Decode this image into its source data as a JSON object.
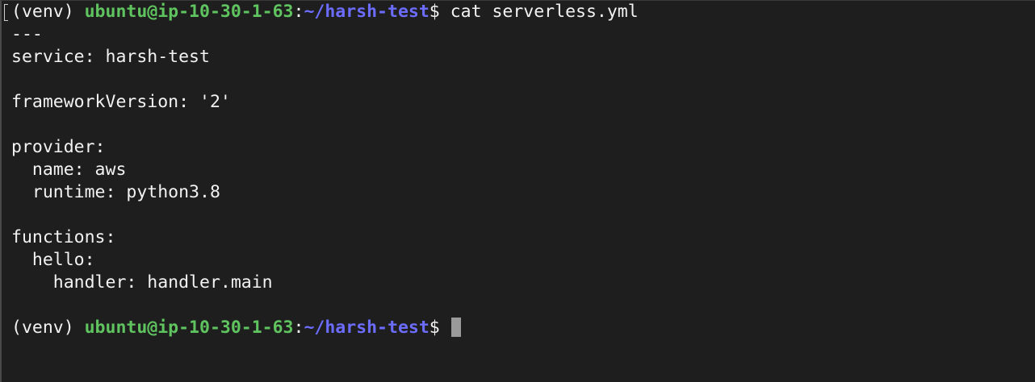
{
  "terminal": {
    "prompt": {
      "venv": "(venv) ",
      "user_host": "ubuntu@ip-10-30-1-63",
      "colon": ":",
      "path": "~/harsh-test",
      "dollar": "$ "
    },
    "command": "cat serverless.yml",
    "output_lines": [
      "---",
      "service: harsh-test",
      "",
      "frameworkVersion: '2'",
      "",
      "provider:",
      "  name: aws",
      "  runtime: python3.8",
      "",
      "functions:",
      "  hello:",
      "    handler: handler.main",
      ""
    ],
    "colors": {
      "background": "#1e1e1e",
      "user_host": "#5fc35f",
      "path": "#6c6cff",
      "text": "#f2f2f2",
      "cursor": "#9a9a9a"
    }
  }
}
